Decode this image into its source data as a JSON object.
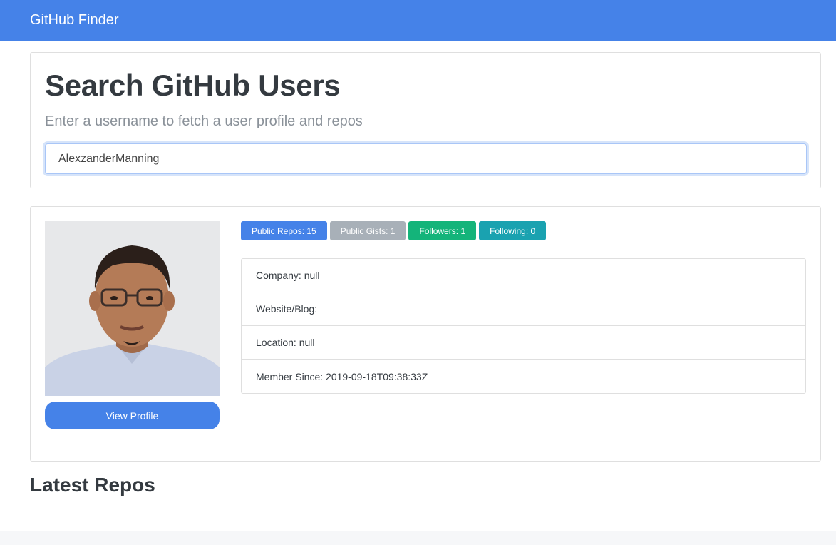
{
  "navbar": {
    "brand": "GitHub Finder"
  },
  "search": {
    "title": "Search GitHub Users",
    "lead": "Enter a username to fetch a user profile and repos",
    "input_value": "AlexzanderManning"
  },
  "profile": {
    "view_profile_label": "View Profile",
    "badges": [
      {
        "label": "Public Repos: 15",
        "color": "#4582e8"
      },
      {
        "label": "Public Gists: 1",
        "color": "#a8b0b8"
      },
      {
        "label": "Followers: 1",
        "color": "#14b47a"
      },
      {
        "label": "Following: 0",
        "color": "#1aa2b0"
      }
    ],
    "info": [
      {
        "label": "Company: null"
      },
      {
        "label": "Website/Blog:"
      },
      {
        "label": "Location: null"
      },
      {
        "label": "Member Since: 2019-09-18T09:38:33Z"
      }
    ]
  },
  "repos": {
    "title": "Latest Repos"
  },
  "colors": {
    "primary": "#4582e8",
    "secondary": "#a8b0b8",
    "success": "#14b47a",
    "info": "#1aa2b0"
  }
}
